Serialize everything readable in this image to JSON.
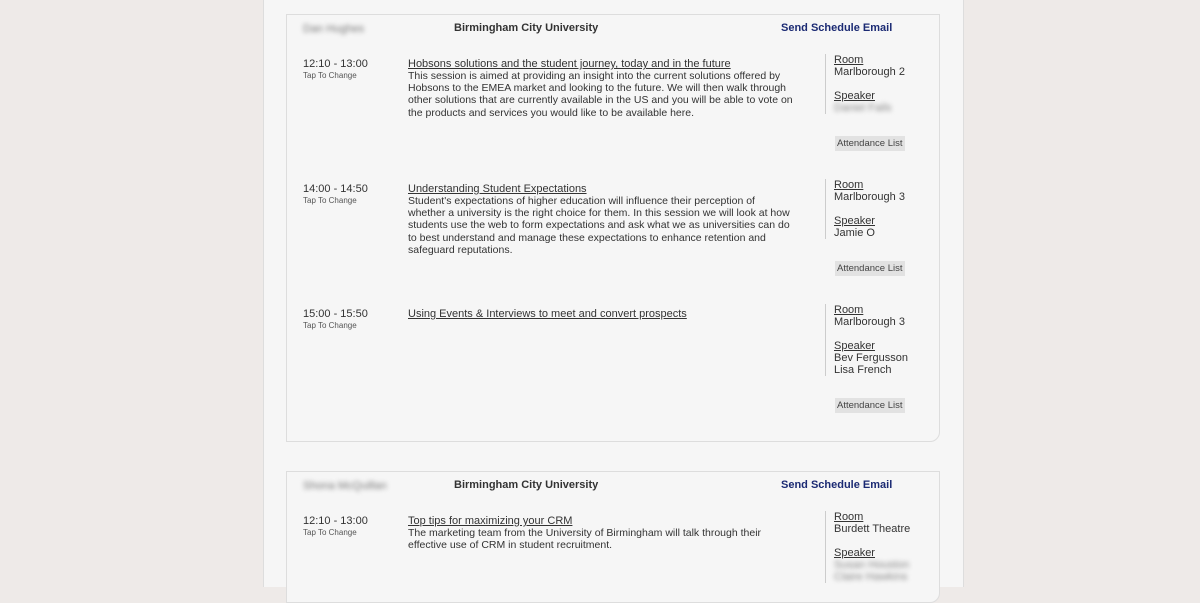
{
  "cards": [
    {
      "attendee": "Dan Hughes",
      "university": "Birmingham City University",
      "send_email": "Send Schedule Email",
      "sessions": [
        {
          "time": "12:10 - 13:00",
          "tap": "Tap To Change",
          "title": "Hobsons solutions and the student journey, today and in the future",
          "description": "This session is aimed at providing an insight into the current solutions offered by Hobsons to the EMEA market and looking to the future. We will then walk through other solutions that are currently available in the US and you will be able to vote on the products and services you would like to be available here.",
          "room_label": "Room",
          "room": "Marlborough 2",
          "speaker_label": "Speaker",
          "speakers": [
            "Daniel Fails"
          ],
          "attendance": "Attendance List"
        },
        {
          "time": "14:00 - 14:50",
          "tap": "Tap To Change",
          "title": "Understanding Student Expectations",
          "description": "Student's expectations of higher education will influence their perception of whether a university is the right choice for them. In this session we will look at how students use the web to form expectations and ask what we as universities can do to best understand and manage these expectations to enhance retention and safeguard reputations.",
          "room_label": "Room",
          "room": "Marlborough 3",
          "speaker_label": "Speaker",
          "speakers": [
            "Jamie O"
          ],
          "attendance": "Attendance List"
        },
        {
          "time": "15:00 - 15:50",
          "tap": "Tap To Change",
          "title": "Using Events & Interviews to meet and convert prospects",
          "description": "",
          "room_label": "Room",
          "room": "Marlborough 3",
          "speaker_label": "Speaker",
          "speakers": [
            "Bev Fergusson",
            "Lisa French"
          ],
          "attendance": "Attendance List"
        }
      ]
    },
    {
      "attendee": "Shona McQuillan",
      "university": "Birmingham City University",
      "send_email": "Send Schedule Email",
      "sessions": [
        {
          "time": "12:10 - 13:00",
          "tap": "Tap To Change",
          "title": "Top tips for maximizing your CRM",
          "description": "The marketing team from the University of Birmingham will talk through their effective use of CRM in student recruitment.",
          "room_label": "Room",
          "room": "Burdett Theatre",
          "speaker_label": "Speaker",
          "speakers": [
            "Susan Houston",
            "Claire Hawkins"
          ]
        }
      ]
    }
  ]
}
